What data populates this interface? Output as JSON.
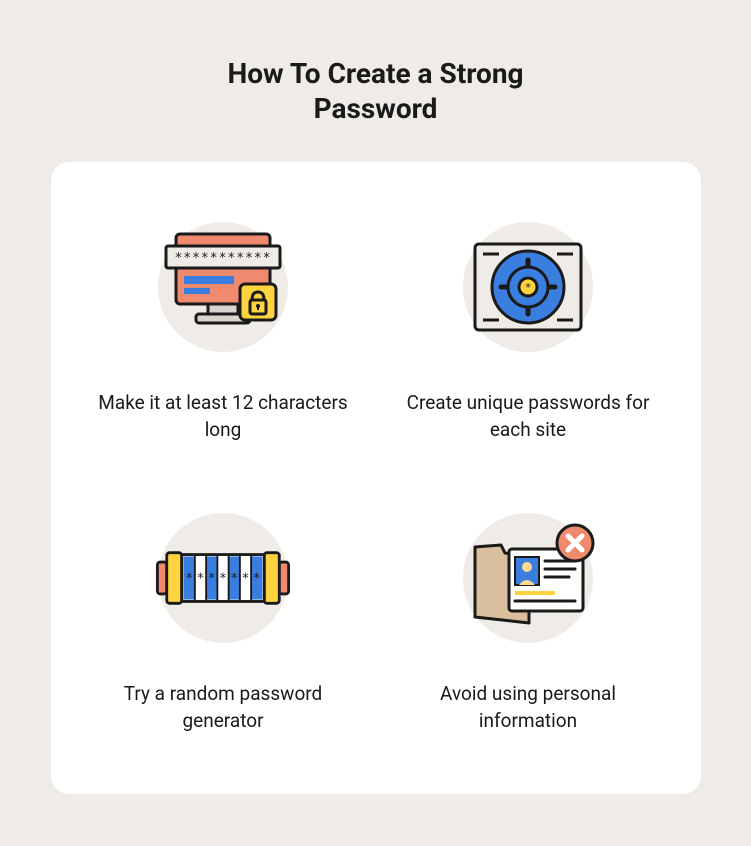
{
  "title": "How To Create a Strong Password",
  "tips": [
    {
      "label": "Make it at least 12 characters long"
    },
    {
      "label": "Create unique passwords for each site"
    },
    {
      "label": "Try a random password generator"
    },
    {
      "label": "Avoid using personal information"
    }
  ],
  "colors": {
    "background": "#efebe6",
    "card": "#ffffff",
    "accentBlue": "#3a7fe0",
    "accentYellow": "#ffd23f",
    "accentCoral": "#ef8a6f",
    "accentTan": "#d9bf9e",
    "textDark": "#1a1a1a"
  }
}
